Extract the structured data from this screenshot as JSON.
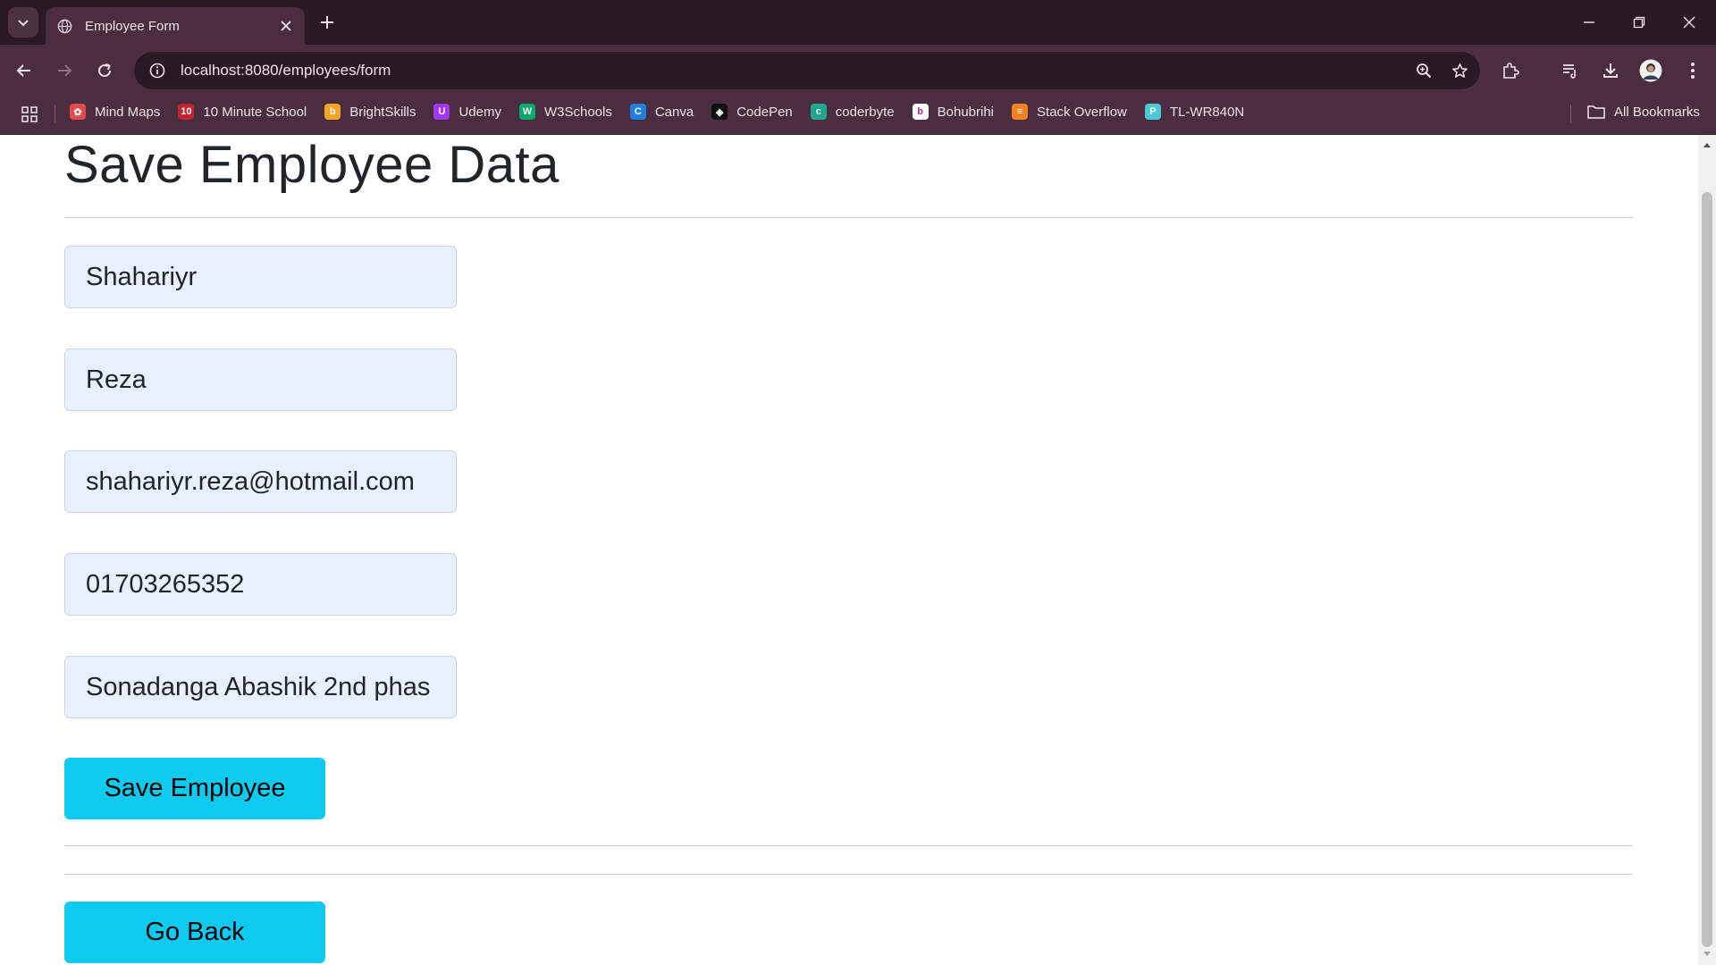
{
  "browser": {
    "tab_title": "Employee Form",
    "url": "localhost:8080/employees/form",
    "bookmarks": [
      {
        "label": "Mind Maps",
        "color": "#e5484d",
        "glyph": "✿"
      },
      {
        "label": "10 Minute School",
        "color": "#c0262d",
        "glyph": "10"
      },
      {
        "label": "BrightSkills",
        "color": "#f5a524",
        "glyph": "b"
      },
      {
        "label": "Udemy",
        "color": "#a435f0",
        "glyph": "U"
      },
      {
        "label": "W3Schools",
        "color": "#04aa6d",
        "glyph": "W"
      },
      {
        "label": "Canva",
        "color": "#1f7fe0",
        "glyph": "C"
      },
      {
        "label": "CodePen",
        "color": "#111111",
        "glyph": "◈"
      },
      {
        "label": "coderbyte",
        "color": "#1fa88e",
        "glyph": "c"
      },
      {
        "label": "Bohubrihi",
        "color": "#ffffff",
        "glyph": "b"
      },
      {
        "label": "Stack Overflow",
        "color": "#f48024",
        "glyph": "≡"
      },
      {
        "label": "TL-WR840N",
        "color": "#4acbd6",
        "glyph": "P"
      }
    ],
    "all_bookmarks_label": "All Bookmarks"
  },
  "page": {
    "title": "Save Employee Data",
    "fields": {
      "first_name": "Shahariyr",
      "last_name": "Reza",
      "email": "shahariyr.reza@hotmail.com",
      "phone": "01703265352",
      "address": "Sonadanga Abashik 2nd phas"
    },
    "save_button": "Save Employee",
    "back_button": "Go Back"
  },
  "colors": {
    "button_accent": "#0dcaf0",
    "field_background": "#e8f0fe",
    "chrome_dark": "#2b1a25",
    "chrome_mid": "#4a2e3f"
  }
}
